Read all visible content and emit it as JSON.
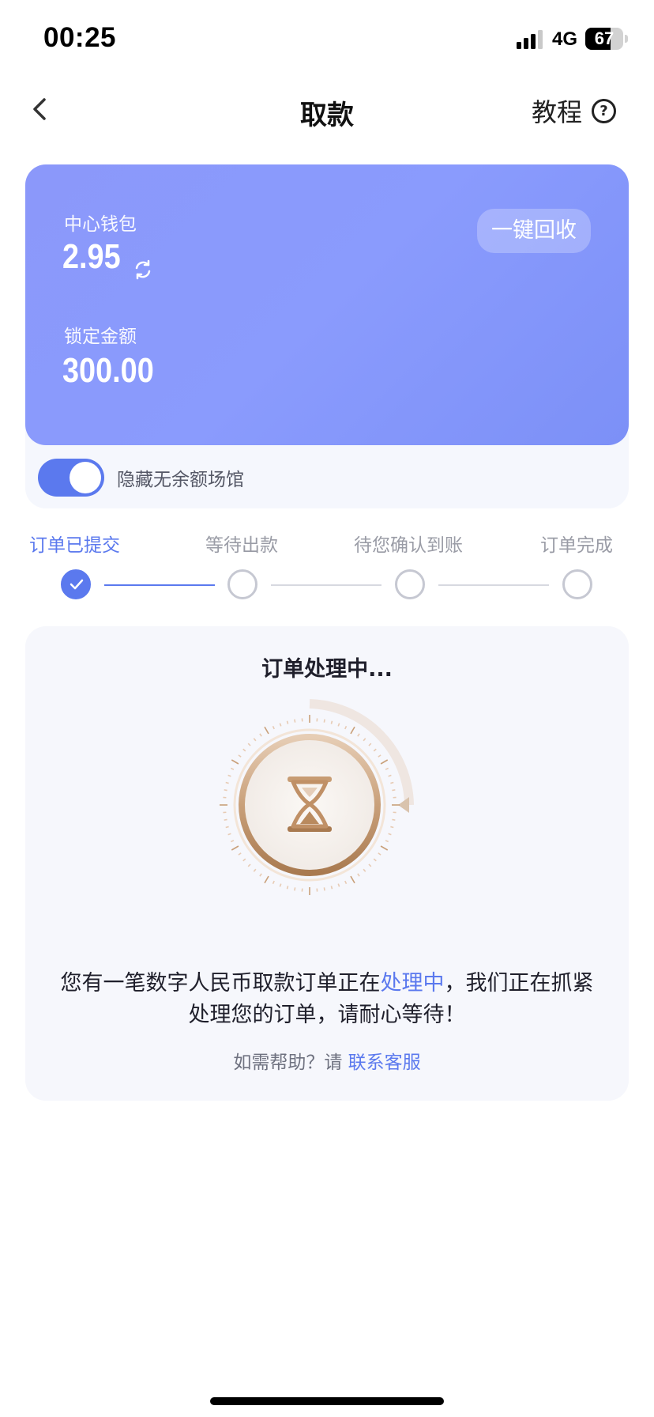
{
  "status_bar": {
    "time": "00:25",
    "network": "4G",
    "battery": "67",
    "battery_level": 0.67
  },
  "nav": {
    "title": "取款",
    "tutorial_label": "教程",
    "help_icon": "?"
  },
  "wallet": {
    "center_wallet_label": "中心钱包",
    "center_wallet_value": "2.95",
    "locked_label": "锁定金额",
    "locked_value": "300.00",
    "recycle_button": "一键回收",
    "hide_toggle_label": "隐藏无余额场馆",
    "hide_toggle_on": true,
    "card_color": "#8a9bfd"
  },
  "steps": [
    {
      "label": "订单已提交",
      "status": "done"
    },
    {
      "label": "等待出款",
      "status": "pending"
    },
    {
      "label": "待您确认到账",
      "status": "pending"
    },
    {
      "label": "订单完成",
      "status": "pending"
    }
  ],
  "panel": {
    "title": "订单处理中...",
    "message_before": "您有一笔数字人民币取款订单正在",
    "message_highlight": "处理中",
    "message_after": "，我们正在抓紧处理您的订单，请耐心等待！",
    "help_prefix": "如需帮助？请",
    "help_link": "联系客服"
  },
  "colors": {
    "accent": "#5b79ee",
    "gold": "#b98a5e"
  }
}
